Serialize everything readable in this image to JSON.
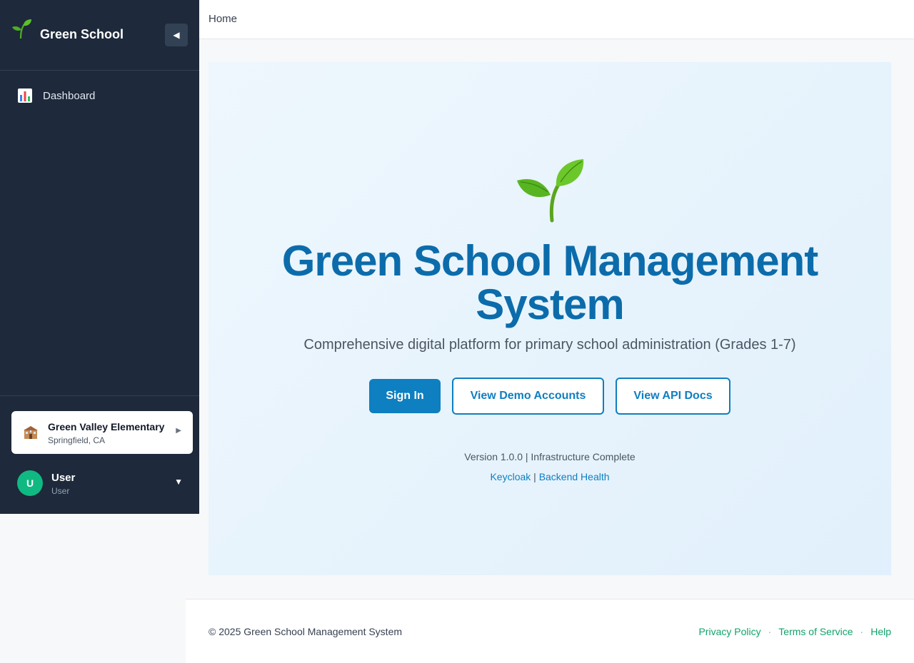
{
  "sidebar": {
    "title": "Green School",
    "logo_icon": "sprout-icon",
    "collapse_label": "◀",
    "nav": [
      {
        "label": "Dashboard",
        "icon": "bar-chart-icon"
      }
    ],
    "school": {
      "name": "Green Valley Elementary",
      "location": "Springfield, CA",
      "icon": "school-icon",
      "arrow": "▶"
    },
    "user": {
      "initial": "U",
      "name": "User",
      "role": "User",
      "caret": "▼"
    }
  },
  "topbar": {
    "breadcrumb": "Home"
  },
  "hero": {
    "icon": "sprout-icon",
    "title_line1": "Green School Management",
    "title_line2": "System",
    "subtitle": "Comprehensive digital platform for primary school administration (Grades 1-7)",
    "buttons": {
      "sign_in": "Sign In",
      "demo": "View Demo Accounts",
      "api": "View API Docs"
    },
    "version": "Version 1.0.0 | Infrastructure Complete",
    "links": {
      "keycloak": "Keycloak",
      "separator": " | ",
      "backend": "Backend Health"
    }
  },
  "footer": {
    "copyright": "© 2025 Green School Management System",
    "links": [
      "Privacy Policy",
      "Terms of Service",
      "Help"
    ],
    "separator": "·"
  },
  "colors": {
    "sidebar_bg": "#1e293b",
    "brand_blue": "#0e7fc0",
    "title_blue": "#0c6cab",
    "footer_link_green": "#10a36b",
    "avatar_green": "#10b981"
  }
}
